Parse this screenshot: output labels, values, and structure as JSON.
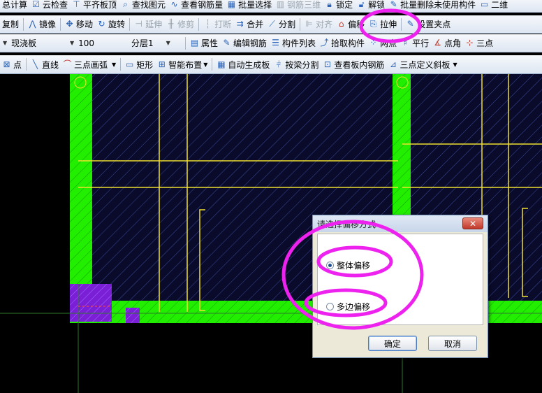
{
  "toolbar1": {
    "items": [
      "总计算",
      "云检查",
      "平齐板顶",
      "查找图元",
      "查看钢筋量",
      "批量选择",
      "钢筋三维",
      "锁定",
      "解锁",
      "批量删除未使用构件",
      "二维"
    ]
  },
  "toolbar2": {
    "items": [
      "复制",
      "镜像",
      "移动",
      "旋转",
      "延伸",
      "修剪",
      "打断",
      "合并",
      "分割",
      "对齐",
      "偏移",
      "拉伸",
      "设置夹点"
    ]
  },
  "toolbar3": {
    "type_value": "现浇板",
    "name_value": "100",
    "layer_value": "分层1",
    "items": [
      "属性",
      "编辑钢筋",
      "构件列表",
      "拾取构件",
      "两点",
      "平行",
      "点角",
      "三点"
    ]
  },
  "toolbar4": {
    "items": [
      "点",
      "直线",
      "三点画弧",
      "矩形",
      "智能布置",
      "自动生成板",
      "按梁分割",
      "查看板内钢筋",
      "三点定义斜板"
    ]
  },
  "dialog": {
    "title": "请选择偏移方式",
    "close": "✕",
    "option_whole": "整体偏移",
    "option_multi": "多边偏移",
    "ok": "确定",
    "cancel": "取消"
  },
  "colors": {
    "canvas_bg": "#000000",
    "slab_bg": "#0a0a2a",
    "hatch": "#3a4a9a",
    "beam_green": "#22ee00",
    "grid_yellow": "#f0e030",
    "column_purple": "#7a1fd6",
    "annotation_magenta": "#ee22ee"
  }
}
